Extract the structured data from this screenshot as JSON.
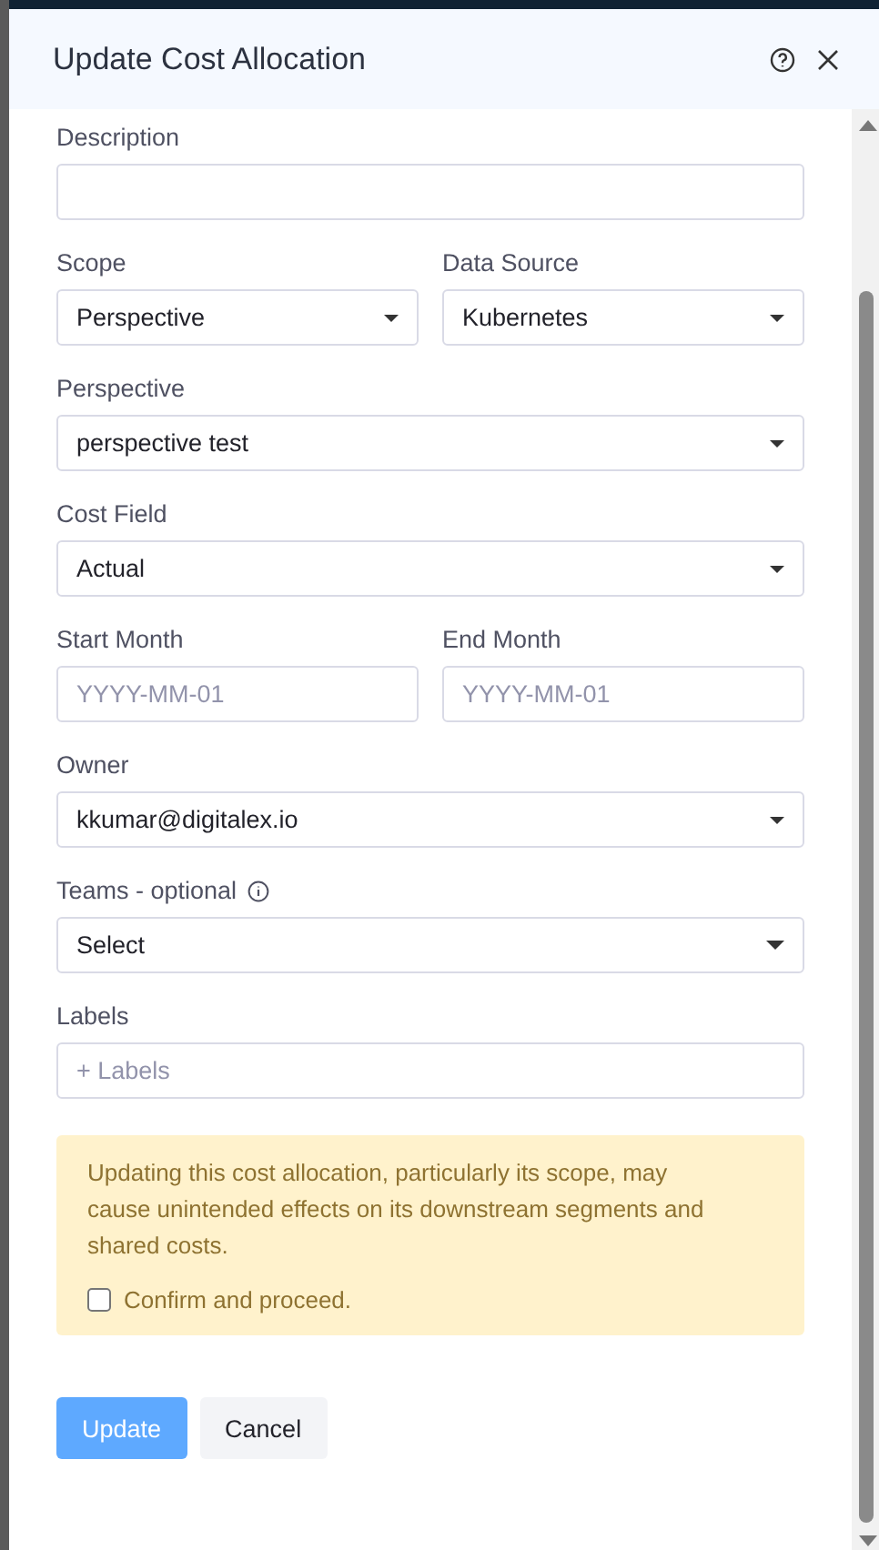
{
  "dialog": {
    "title": "Update Cost Allocation"
  },
  "rows": [
    [
      {
        "kind": "input",
        "label": "Description"
      }
    ],
    [
      {
        "kind": "select",
        "label": "Scope",
        "value": "Perspective"
      },
      {
        "kind": "select",
        "label": "Data Source",
        "value": "Kubernetes"
      }
    ],
    [
      {
        "kind": "select",
        "label": "Perspective",
        "value": "perspective test"
      }
    ],
    [
      {
        "kind": "select",
        "label": "Cost Field",
        "value": "Actual"
      }
    ],
    [
      {
        "kind": "input",
        "label": "Start Month",
        "placeholder": "YYYY-MM-01"
      },
      {
        "kind": "input",
        "label": "End Month",
        "placeholder": "YYYY-MM-01"
      }
    ],
    [
      {
        "kind": "select",
        "label": "Owner",
        "value": "kkumar@digitalex.io"
      }
    ],
    [
      {
        "kind": "select",
        "label": "Teams - optional",
        "value": "Select",
        "info": true
      }
    ],
    [
      {
        "kind": "input",
        "label": "Labels",
        "placeholder": "+ Labels"
      }
    ]
  ],
  "warning": {
    "text": "Updating this cost allocation, particularly its scope, may cause unintended effects on its downstream segments and shared costs.",
    "checkbox": {
      "label": "Confirm and proceed.",
      "checked": false
    }
  },
  "buttons": [
    {
      "label": "Update",
      "kind": "primary",
      "disabled": true
    },
    {
      "label": "Cancel",
      "kind": "secondary",
      "disabled": false
    }
  ]
}
